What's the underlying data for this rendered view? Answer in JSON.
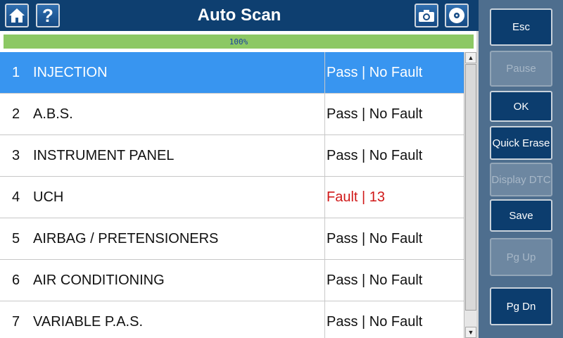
{
  "header": {
    "title": "Auto Scan",
    "help_glyph": "?"
  },
  "progress": {
    "percent": 100,
    "label": "100%",
    "fill_color": "#8cc864"
  },
  "list": {
    "selected_index": 0,
    "rows": [
      {
        "num": "1",
        "name": "INJECTION",
        "status": "Pass | No Fault",
        "fault": false
      },
      {
        "num": "2",
        "name": "A.B.S.",
        "status": "Pass | No Fault",
        "fault": false
      },
      {
        "num": "3",
        "name": "INSTRUMENT PANEL",
        "status": "Pass | No Fault",
        "fault": false
      },
      {
        "num": "4",
        "name": "UCH",
        "status": "Fault | 13",
        "fault": true
      },
      {
        "num": "5",
        "name": "AIRBAG / PRETENSIONERS",
        "status": "Pass | No Fault",
        "fault": false
      },
      {
        "num": "6",
        "name": "AIR CONDITIONING",
        "status": "Pass | No Fault",
        "fault": false
      },
      {
        "num": "7",
        "name": "VARIABLE P.A.S.",
        "status": "Pass | No Fault",
        "fault": false
      }
    ]
  },
  "sidebar": {
    "esc": "Esc",
    "pause": "Pause",
    "ok": "OK",
    "quick_erase": "Quick Erase",
    "display_dtc": "Display DTC",
    "save": "Save",
    "pg_up": "Pg Up",
    "pg_dn": "Pg Dn"
  },
  "icons": {
    "home": "home-icon",
    "help": "help-icon",
    "camera": "camera-icon",
    "disc": "disc-icon"
  },
  "colors": {
    "header_bg": "#0e3f70",
    "selected_row": "#3895f0",
    "fault_text": "#d01818",
    "sidebar_bg": "#4e6e8e",
    "button_bg": "#0c3d6e"
  }
}
